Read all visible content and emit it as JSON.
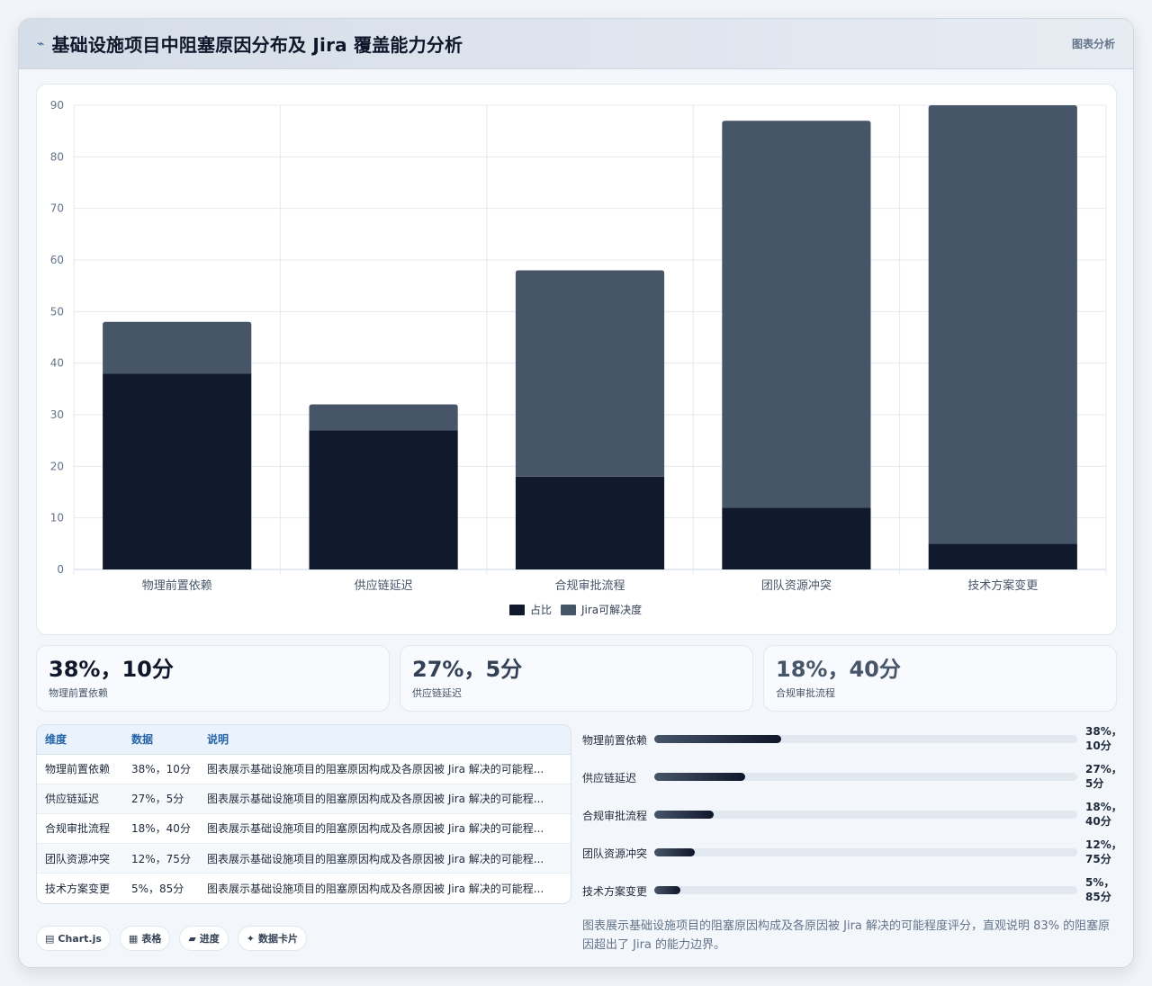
{
  "header": {
    "title": "基础设施项目中阻塞原因分布及 Jira 覆盖能力分析",
    "tag": "图表分析"
  },
  "chart_data": {
    "type": "bar",
    "stacked": true,
    "categories": [
      "物理前置依赖",
      "供应链延迟",
      "合规审批流程",
      "团队资源冲突",
      "技术方案变更"
    ],
    "series": [
      {
        "name": "占比",
        "values": [
          38,
          27,
          18,
          12,
          5
        ],
        "color": "#111a2c"
      },
      {
        "name": "Jira可解决度",
        "values": [
          10,
          5,
          40,
          75,
          85
        ],
        "color": "#475569"
      }
    ],
    "ylim": [
      0,
      90
    ],
    "yticks": [
      0,
      10,
      20,
      30,
      40,
      50,
      60,
      70,
      80,
      90
    ],
    "grid": true,
    "legend": "bottom"
  },
  "stats": [
    {
      "value": "38%，10分",
      "label": "物理前置依赖",
      "color": "#0f172a"
    },
    {
      "value": "27%，5分",
      "label": "供应链延迟",
      "color": "#334155"
    },
    {
      "value": "18%，40分",
      "label": "合规审批流程",
      "color": "#475569"
    }
  ],
  "table": {
    "headers": [
      "维度",
      "数据",
      "说明"
    ],
    "rows": [
      [
        "物理前置依赖",
        "38%，10分",
        "图表展示基础设施项目的阻塞原因构成及各原因被 Jira 解决的可能程..."
      ],
      [
        "供应链延迟",
        "27%，5分",
        "图表展示基础设施项目的阻塞原因构成及各原因被 Jira 解决的可能程..."
      ],
      [
        "合规审批流程",
        "18%，40分",
        "图表展示基础设施项目的阻塞原因构成及各原因被 Jira 解决的可能程..."
      ],
      [
        "团队资源冲突",
        "12%，75分",
        "图表展示基础设施项目的阻塞原因构成及各原因被 Jira 解决的可能程..."
      ],
      [
        "技术方案变更",
        "5%，85分",
        "图表展示基础设施项目的阻塞原因构成及各原因被 Jira 解决的可能程..."
      ]
    ]
  },
  "progress": [
    {
      "label": "物理前置依赖",
      "value": "38%，10分",
      "fraction": 0.3
    },
    {
      "label": "供应链延迟",
      "value": "27%，5分",
      "fraction": 0.215
    },
    {
      "label": "合规审批流程",
      "value": "18%，40分",
      "fraction": 0.14
    },
    {
      "label": "团队资源冲突",
      "value": "12%，75分",
      "fraction": 0.095
    },
    {
      "label": "技术方案变更",
      "value": "5%，85分",
      "fraction": 0.062
    }
  ],
  "chips": [
    {
      "icon": "▤",
      "label": "Chart.js"
    },
    {
      "icon": "▦",
      "label": "表格"
    },
    {
      "icon": "▰",
      "label": "进度"
    },
    {
      "icon": "✦",
      "label": "数据卡片"
    }
  ],
  "note": "图表展示基础设施项目的阻塞原因构成及各原因被 Jira 解决的可能程度评分，直观说明 83% 的阻塞原因超出了 Jira 的能力边界。"
}
